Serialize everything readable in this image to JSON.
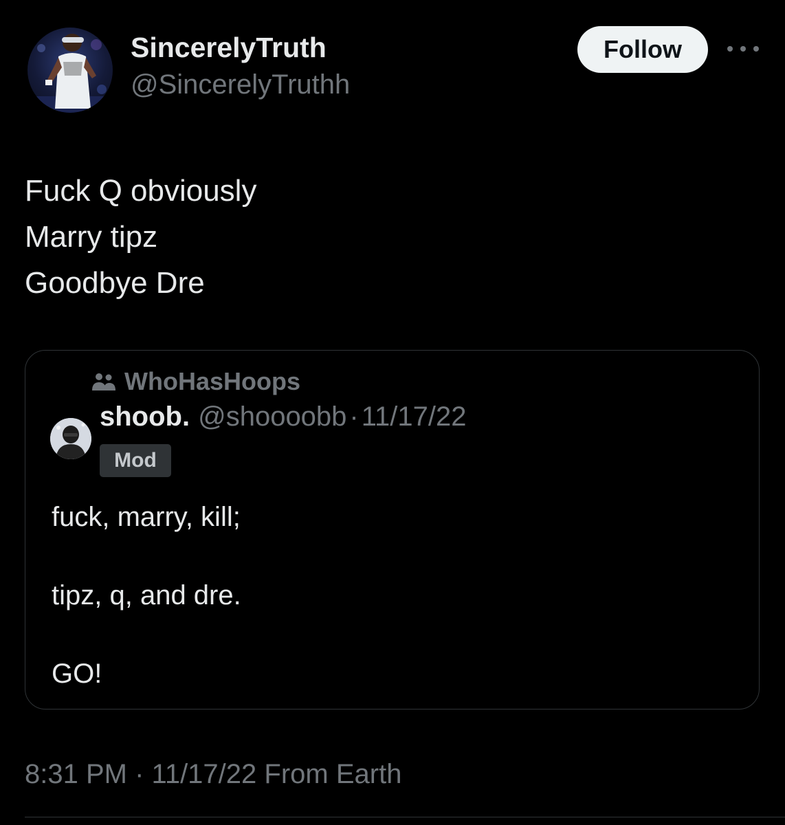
{
  "tweet": {
    "display_name": "SincerelyTruth",
    "handle": "@SincerelyTruthh",
    "follow_label": "Follow",
    "more_icon": "more-horizontal-icon",
    "text_lines": [
      "Fuck Q obviously",
      "Marry tipz",
      "Goodbye Dre"
    ],
    "timestamp": "8:31 PM",
    "date": "11/17/22",
    "source": "From Earth",
    "meta_separator": "·"
  },
  "quote": {
    "community_icon": "community-icon",
    "community_name": "WhoHasHoops",
    "display_name": "shoob.",
    "handle": "@shoooobb",
    "separator": "·",
    "date": "11/17/22",
    "badge": "Mod",
    "text_lines": [
      "fuck, marry, kill;",
      "",
      "tipz, q, and dre.",
      "",
      "GO!"
    ]
  },
  "colors": {
    "background": "#000000",
    "primary_text": "#e7e9ea",
    "secondary_text": "#71767b",
    "follow_button_bg": "#eff3f4",
    "border": "#2f3336"
  }
}
